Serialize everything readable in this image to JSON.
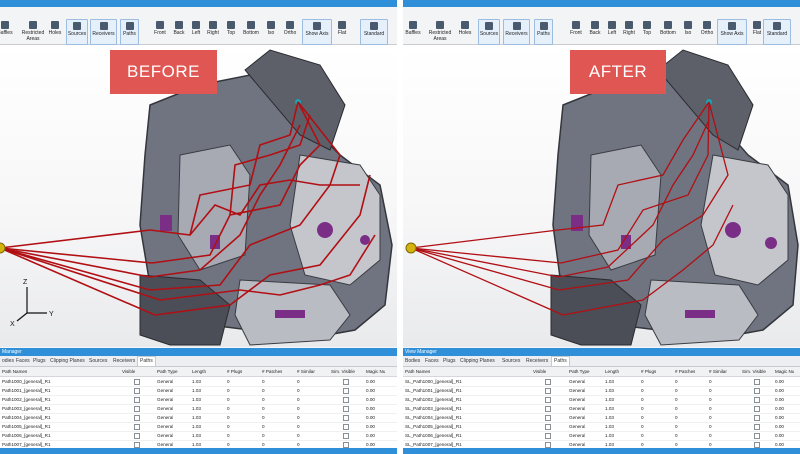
{
  "colors": {
    "accent": "#2f8fd8",
    "stamp": "#e05652",
    "path_line": "#b10f14",
    "marker": "#d4b40a",
    "body_gray": "#6e727a"
  },
  "toolbar": {
    "buttons_left": [
      {
        "label": "Baffles",
        "icon": "baffle-icon"
      },
      {
        "label": "Restricted Areas",
        "icon": "restricted-areas-icon"
      },
      {
        "label": "Holes",
        "icon": "holes-icon"
      },
      {
        "label": "Sources",
        "icon": "speaker-icon"
      },
      {
        "label": "Receivers",
        "icon": "receiver-icon"
      },
      {
        "label": "Paths",
        "icon": "paths-icon"
      }
    ],
    "buttons_view": [
      {
        "label": "Front",
        "icon": "cube-front-icon"
      },
      {
        "label": "Back",
        "icon": "cube-back-icon"
      },
      {
        "label": "Left",
        "icon": "cube-left-icon"
      },
      {
        "label": "Right",
        "icon": "cube-right-icon"
      },
      {
        "label": "Top",
        "icon": "cube-top-icon"
      },
      {
        "label": "Bottom",
        "icon": "cube-bottom-icon"
      },
      {
        "label": "Iso",
        "icon": "cube-iso-icon"
      },
      {
        "label": "Ortho",
        "icon": "ortho-icon"
      },
      {
        "label": "Show Axis",
        "icon": "axis-icon"
      },
      {
        "label": "Flat",
        "icon": "flat-shading-icon"
      },
      {
        "label": "Standard",
        "icon": "standard-view-icon"
      }
    ]
  },
  "left": {
    "stamp": "BEFORE",
    "manager_title": "Manager",
    "tabs": [
      "odies",
      "Faces",
      "Plugs",
      "Clipping Planes",
      "Sources",
      "Receivers",
      "Paths"
    ],
    "headers": [
      "Path Names",
      "Visible",
      "Path Type",
      "Length",
      "# Plugs",
      "# Patches",
      "# Similar",
      "Sim. Visible",
      "Magic Nu"
    ],
    "rows": [
      [
        "Path1000_[general]_R1",
        "General",
        "1.03",
        "0",
        "0",
        "0",
        "0.00"
      ],
      [
        "Path1001_[general]_R1",
        "General",
        "1.03",
        "0",
        "0",
        "0",
        "0.00"
      ],
      [
        "Path1002_[general]_R1",
        "General",
        "1.03",
        "0",
        "0",
        "0",
        "0.00"
      ],
      [
        "Path1003_[general]_R1",
        "General",
        "1.03",
        "0",
        "0",
        "0",
        "0.00"
      ],
      [
        "Path1004_[general]_R1",
        "General",
        "1.03",
        "0",
        "0",
        "0",
        "0.00"
      ],
      [
        "Path1005_[general]_R1",
        "General",
        "1.03",
        "0",
        "0",
        "0",
        "0.00"
      ],
      [
        "Path1006_[general]_R1",
        "General",
        "1.03",
        "0",
        "0",
        "0",
        "0.00"
      ],
      [
        "Path1007_[general]_R1",
        "General",
        "1.03",
        "0",
        "0",
        "0",
        "0.00"
      ]
    ]
  },
  "right": {
    "stamp": "AFTER",
    "manager_title": "View Manager",
    "tabs": [
      "Bodies",
      "Faces",
      "Plugs",
      "Clipping Planes",
      "Sources",
      "Receivers",
      "Paths"
    ],
    "headers": [
      "Path Names",
      "Visible",
      "Path Type",
      "Length",
      "# Plugs",
      "# Patches",
      "# Similar",
      "Sim. Visible",
      "Magic Nu"
    ],
    "rows": [
      [
        "SL_Path1000_[general]_R1",
        "General",
        "1.03",
        "0",
        "0",
        "0",
        "0.00"
      ],
      [
        "SL_Path1001_[general]_R1",
        "General",
        "1.03",
        "0",
        "0",
        "0",
        "0.00"
      ],
      [
        "SL_Path1002_[general]_R1",
        "General",
        "1.03",
        "0",
        "0",
        "0",
        "0.00"
      ],
      [
        "SL_Path1003_[general]_R1",
        "General",
        "1.03",
        "0",
        "0",
        "0",
        "0.00"
      ],
      [
        "SL_Path1004_[general]_R1",
        "General",
        "1.03",
        "0",
        "0",
        "0",
        "0.00"
      ],
      [
        "SL_Path1005_[general]_R1",
        "General",
        "1.03",
        "0",
        "0",
        "0",
        "0.00"
      ],
      [
        "SL_Path1006_[general]_R1",
        "General",
        "1.03",
        "0",
        "0",
        "0",
        "0.00"
      ],
      [
        "SL_Path1007_[general]_R1",
        "General",
        "1.03",
        "0",
        "0",
        "0",
        "0.00"
      ]
    ]
  },
  "axes": {
    "z": "Z",
    "x": "X",
    "y": "Y"
  }
}
